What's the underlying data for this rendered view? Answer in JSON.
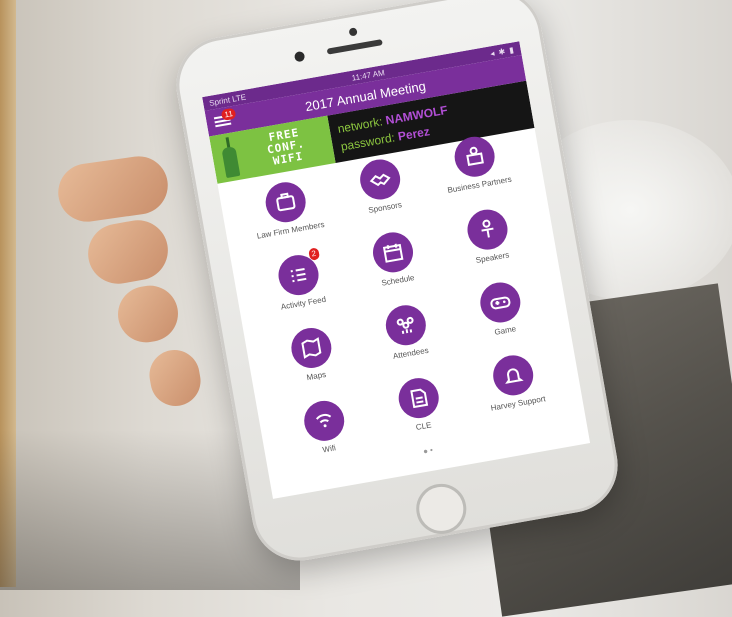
{
  "status_bar": {
    "carrier": "Sprint LTE",
    "time": "11:47 AM",
    "icons": "◂ ✱ ▮"
  },
  "app": {
    "title": "2017 Annual Meeting",
    "menu_badge": "11"
  },
  "banner": {
    "promo_lines": [
      "FREE",
      "CONF.",
      "WIFI"
    ],
    "network_label": "network:",
    "network_value": "NAMWOLF",
    "password_label": "password:",
    "password_value": "Perez"
  },
  "tiles": [
    {
      "label": "Law Firm Members",
      "icon": "briefcase-icon"
    },
    {
      "label": "Sponsors",
      "icon": "handshake-icon"
    },
    {
      "label": "Business Partners",
      "icon": "building-icon"
    },
    {
      "label": "Activity Feed",
      "icon": "list-icon",
      "badge": "2"
    },
    {
      "label": "Schedule",
      "icon": "calendar-icon"
    },
    {
      "label": "Speakers",
      "icon": "speaker-icon"
    },
    {
      "label": "Maps",
      "icon": "map-icon"
    },
    {
      "label": "Attendees",
      "icon": "people-icon"
    },
    {
      "label": "Game",
      "icon": "gamepad-icon"
    },
    {
      "label": "Wifi",
      "icon": "wifi-icon"
    },
    {
      "label": "CLE",
      "icon": "document-icon"
    },
    {
      "label": "Harvey Support",
      "icon": "bell-icon"
    }
  ],
  "page_indicator": "● •",
  "colors": {
    "brand_purple": "#7a2f9b",
    "promo_green": "#7dc242",
    "badge_red": "#e02020"
  }
}
